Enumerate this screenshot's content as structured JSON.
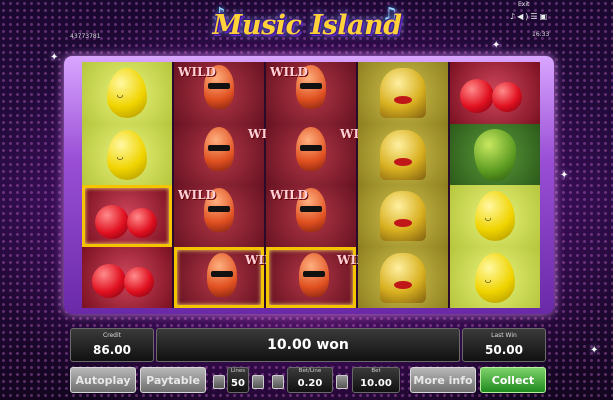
{
  "title": "Music Island",
  "session_id": "43773781",
  "topbar": {
    "exit_label": "Exit",
    "clock": "16:33",
    "icons": [
      "music-icon",
      "speaker-icon",
      "settings-icon",
      "fullscreen-icon"
    ]
  },
  "reels": [
    [
      "lemon",
      "lemon",
      "cherry",
      "cherry"
    ],
    [
      "wild",
      "wild",
      "wild",
      "wild"
    ],
    [
      "wild",
      "wild",
      "wild",
      "wild"
    ],
    [
      "bell",
      "bell",
      "bell",
      "bell"
    ],
    [
      "cherry",
      "pear",
      "lemon",
      "lemon"
    ]
  ],
  "wild_label": "WILD",
  "panels": {
    "credit_label": "Credit",
    "credit_value": "86.00",
    "won_text": "10.00 won",
    "last_win_label": "Last Win",
    "last_win_value": "50.00"
  },
  "controls": {
    "autoplay_label": "Autoplay",
    "paytable_label": "Paytable",
    "lines_label": "Lines",
    "lines_value": "50",
    "bet_line_label": "Bet/Line",
    "bet_line_value": "0.20",
    "bet_label": "Bet",
    "bet_value": "10.00",
    "more_info_label": "More info",
    "collect_label": "Collect"
  },
  "colors": {
    "win_frame": "#f4c400",
    "collect_green": "#1f8a1f",
    "logo_yellow": "#ffd23a"
  }
}
